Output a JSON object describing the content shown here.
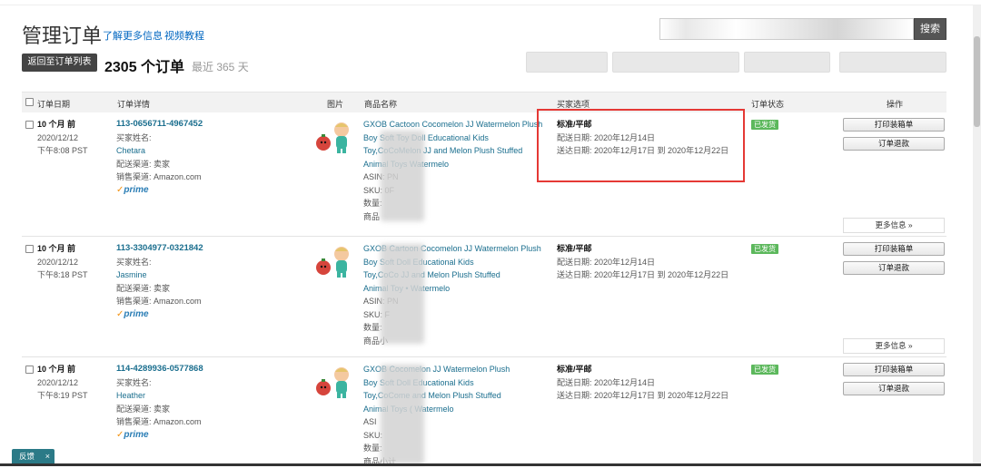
{
  "header": {
    "title": "管理订单",
    "learn_more": "了解更多信息",
    "video": "视频教程",
    "search_button": "搜索",
    "back_button": "返回至订单列表",
    "order_count": "2305 个订单",
    "recent": "最近 365 天"
  },
  "table": {
    "headers": [
      "订单日期",
      "订单详情",
      "图片",
      "商品名称",
      "买家选项",
      "订单状态",
      "操作"
    ]
  },
  "orders": [
    {
      "ago": "10 个月 前",
      "date": "2020/12/12",
      "time": "下午8:08 PST",
      "order_id": "113-0656711-4967452",
      "buyer_label": "买家姓名:",
      "buyer": "Chetara",
      "channel": "配送渠道: 卖家",
      "sales_channel": "销售渠道: Amazon.com",
      "prime": "prime",
      "product_lines": [
        "GXOB Cactoon Cocomelon JJ Watermelon Plush",
        "Boy Soft Toy Doll Educational Kids",
        "Toy,CoCoMelon JJ and Melon Plush Stuffed",
        "Animal Toys Watermelo"
      ],
      "asin": "ASIN: PN",
      "sku": "SKU: 0F",
      "qty": "数量:",
      "subtotal": "商品",
      "ship_option": "标准/平邮",
      "ship_date": "配送日期: 2020年12月14日",
      "delivery": "送达日期: 2020年12月17日 到 2020年12月22日",
      "status": "已发货",
      "print": "打印装箱单",
      "refund": "订单退款",
      "more": "更多信息 »"
    },
    {
      "ago": "10 个月 前",
      "date": "2020/12/12",
      "time": "下午8:18 PST",
      "order_id": "113-3304977-0321842",
      "buyer_label": "买家姓名:",
      "buyer": "Jasmine",
      "channel": "配送渠道: 卖家",
      "sales_channel": "销售渠道: Amazon.com",
      "prime": "prime",
      "product_lines": [
        "GXOB Cartoon Cocomelon JJ Watermelon Plush",
        "Boy Soft Doll Educational Kids",
        "Toy,CoCo JJ and Melon Plush Stuffed",
        "Animal Toy • Watermelo"
      ],
      "asin": "ASIN: PN",
      "sku": "SKU: F",
      "qty": "数量:",
      "subtotal": "商品小",
      "ship_option": "标准/平邮",
      "ship_date": "配送日期: 2020年12月14日",
      "delivery": "送达日期: 2020年12月17日 到 2020年12月22日",
      "status": "已发货",
      "print": "打印装箱单",
      "refund": "订单退款",
      "more": "更多信息 »"
    },
    {
      "ago": "10 个月 前",
      "date": "2020/12/12",
      "time": "下午8:19 PST",
      "order_id": "114-4289936-0577868",
      "buyer_label": "买家姓名:",
      "buyer": "Heather",
      "channel": "配送渠道: 卖家",
      "sales_channel": "销售渠道: Amazon.com",
      "prime": "prime",
      "product_lines": [
        "GXOB Cocomelon JJ Watermelon Plush",
        "Boy Soft Doll Educational Kids",
        "Toy,CoCome and Melon Plush Stuffed",
        "Animal Toys ( Watermelo"
      ],
      "asin": "ASI",
      "sku": "SKU:",
      "qty": "数量:",
      "subtotal": "商品小计",
      "ship_option": "标准/平邮",
      "ship_date": "配送日期: 2020年12月14日",
      "delivery": "送达日期: 2020年12月17日 到 2020年12月22日",
      "status": "已发货",
      "print": "打印装箱单",
      "refund": "订单退款",
      "more": ""
    }
  ],
  "feedback": {
    "label": "反馈",
    "close": "×"
  },
  "colors": {
    "accent": "#1a6e8e",
    "status": "#5cb85c",
    "highlight": "#e53935",
    "prime": "#2a7db5"
  }
}
